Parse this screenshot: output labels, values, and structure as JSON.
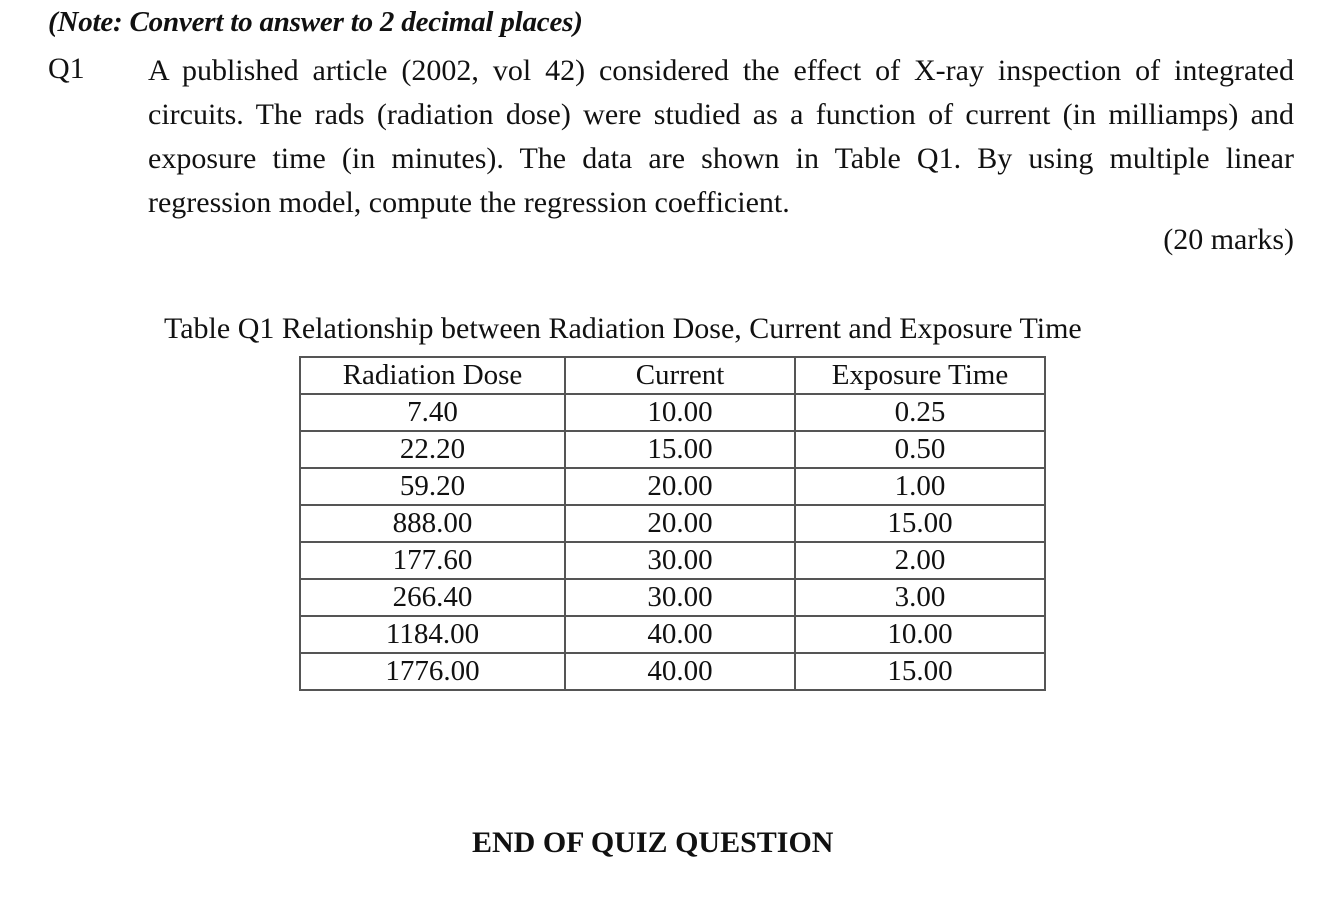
{
  "note": "(Note: Convert to answer to 2 decimal places)",
  "question": {
    "number": "Q1",
    "body": "A published article (2002, vol 42) considered the effect of X-ray inspection of integrated circuits. The rads (radiation dose) were studied as a function of current (in milliamps) and exposure time (in minutes). The data are shown in Table Q1. By using multiple linear regression model, compute the regression coefficient.",
    "marks": "(20 marks)"
  },
  "table": {
    "caption": "Table Q1 Relationship between Radiation Dose, Current and Exposure Time",
    "headers": [
      "Radiation Dose",
      "Current",
      "Exposure Time"
    ],
    "rows": [
      [
        "7.40",
        "10.00",
        "0.25"
      ],
      [
        "22.20",
        "15.00",
        "0.50"
      ],
      [
        "59.20",
        "20.00",
        "1.00"
      ],
      [
        "888.00",
        "20.00",
        "15.00"
      ],
      [
        "177.60",
        "30.00",
        "2.00"
      ],
      [
        "266.40",
        "30.00",
        "3.00"
      ],
      [
        "1184.00",
        "40.00",
        "10.00"
      ],
      [
        "1776.00",
        "40.00",
        "15.00"
      ]
    ]
  },
  "footer": "END OF QUIZ QUESTION"
}
